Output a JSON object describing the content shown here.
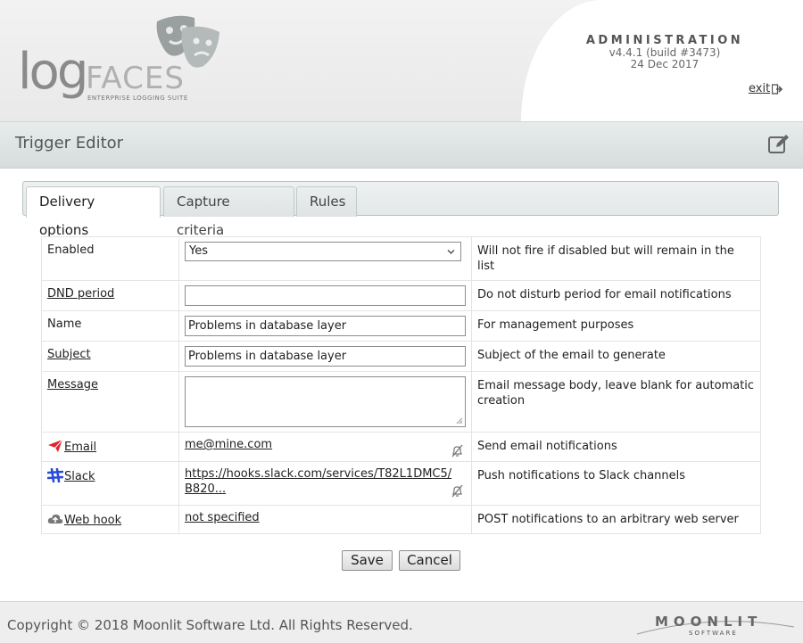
{
  "header": {
    "logo_main": "log",
    "logo_brand": "FACES",
    "logo_tagline": "ENTERPRISE LOGGING SUITE",
    "admin_title": "ADMINISTRATION",
    "version": "v4.4.1 (build #3473)",
    "date": "24 Dec 2017",
    "exit_label": "exit"
  },
  "titlebar": {
    "title": "Trigger Editor",
    "icon": "edit-icon"
  },
  "tabs": [
    {
      "label": "Delivery options",
      "active": true
    },
    {
      "label": "Capture criteria",
      "active": false
    },
    {
      "label": "Rules",
      "active": false
    }
  ],
  "form": {
    "enabled": {
      "label": "Enabled",
      "value": "Yes",
      "desc": "Will not fire if disabled but will remain in the list"
    },
    "dnd": {
      "label": "DND period",
      "value": "",
      "desc": "Do not disturb period for email notifications"
    },
    "name": {
      "label": "Name",
      "value": "Problems in database layer",
      "desc": "For management purposes"
    },
    "subject": {
      "label": "Subject",
      "value": "Problems in database layer",
      "desc": "Subject of the email to generate"
    },
    "message": {
      "label": "Message",
      "value": "",
      "desc": "Email message body, leave blank for automatic creation"
    },
    "email": {
      "label": "Email",
      "value": "me@mine.com",
      "desc": "Send email notifications",
      "icon": "paper-plane-icon"
    },
    "slack": {
      "label": "Slack",
      "value": "https://hooks.slack.com/services/T82L1DMC5/B820...",
      "desc": "Push notifications to Slack channels",
      "icon": "slack-icon"
    },
    "webhook": {
      "label": "Web hook",
      "value": "not specified",
      "desc": "POST notifications to an arbitrary web server",
      "icon": "cloud-upload-icon"
    }
  },
  "buttons": {
    "save": "Save",
    "cancel": "Cancel"
  },
  "footer": {
    "copyright": "Copyright © 2018 Moonlit Software Ltd. All Rights Reserved.",
    "brand": "MOONLIT",
    "brand_sub": "SOFTWARE"
  },
  "colors": {
    "titlebar": "#dde3e3",
    "email_icon": "#e0242b",
    "slack_icon": "#2b4ad6"
  }
}
